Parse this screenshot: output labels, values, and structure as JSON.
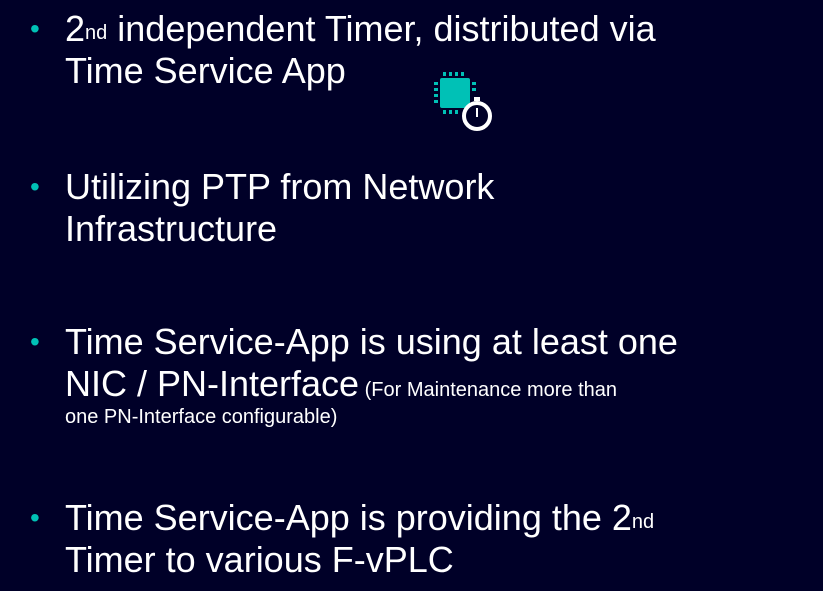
{
  "bullets": [
    {
      "marker": "•",
      "line1_prefix": "2",
      "line1_sup": "nd",
      "line1_text": " independent Timer, distributed via",
      "line2_text": "Time Service App",
      "icon": "timer-chip-icon"
    },
    {
      "marker": "•",
      "line1_text": "Utilizing PTP from Network",
      "line2_text": "Infrastructure"
    },
    {
      "marker": "•",
      "line1_text": "Time Service-App is using at least one",
      "line2_main": "NIC / PN-Interface",
      "line2_small": " (For Maintenance more than",
      "line3_small": "one PN-Interface configurable)"
    },
    {
      "marker": "•",
      "line1_text": "Time Service-App is providing the 2",
      "line1_sup": "nd",
      "line2_text": "Timer to various F-vPLC"
    }
  ],
  "colors": {
    "background": "#000028",
    "text": "#ffffff",
    "accent": "#00c1b6"
  }
}
